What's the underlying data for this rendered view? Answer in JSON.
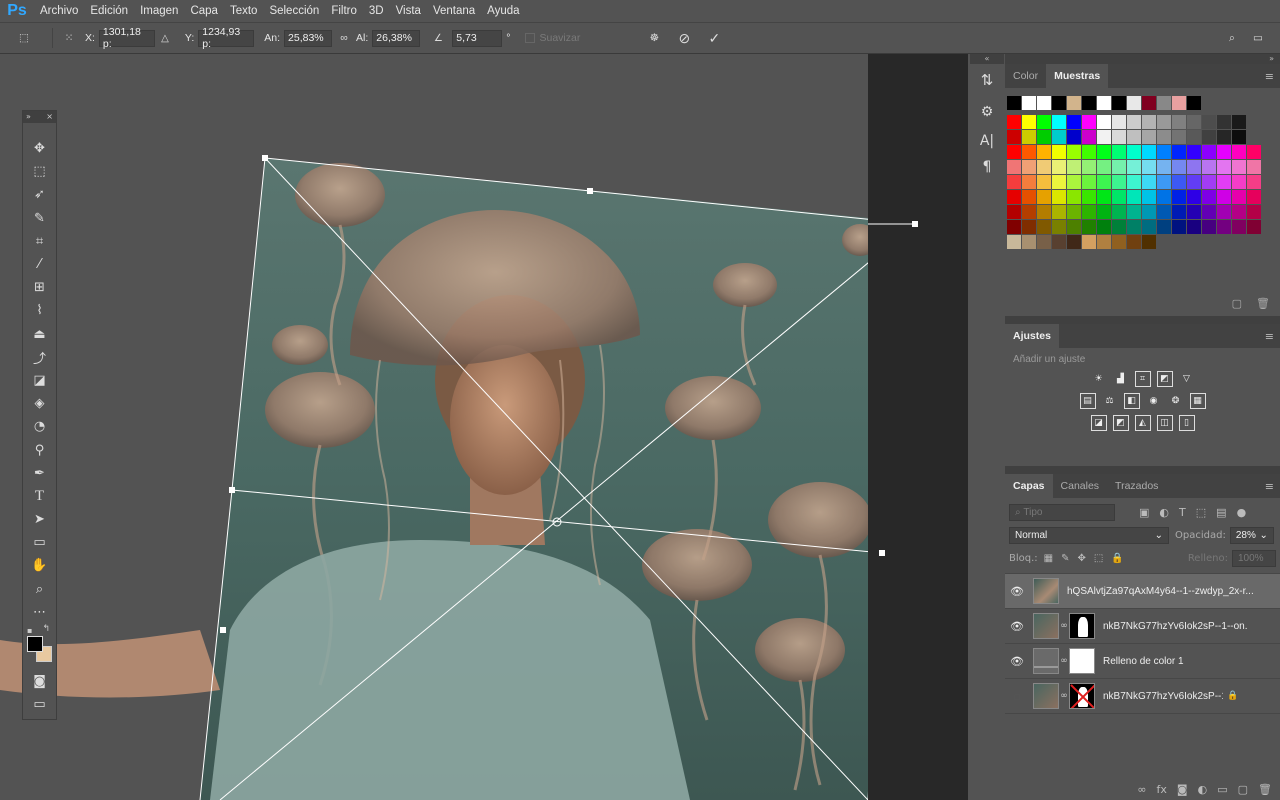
{
  "app": {
    "logo": "Ps"
  },
  "menu": [
    "Archivo",
    "Edición",
    "Imagen",
    "Capa",
    "Texto",
    "Selección",
    "Filtro",
    "3D",
    "Vista",
    "Ventana",
    "Ayuda"
  ],
  "options": {
    "x_label": "X:",
    "x_value": "1301,18 p:",
    "y_label": "Y:",
    "y_value": "1234,93 p:",
    "w_label": "An:",
    "w_value": "25,83%",
    "h_label": "Al:",
    "h_value": "26,38%",
    "angle_value": "5,73",
    "angle_unit": "°",
    "smooth_label": "Suavizar"
  },
  "color_panel": {
    "tabs": [
      "Color",
      "Muestras"
    ],
    "active_tab": "Muestras",
    "recent_swatches": [
      "#000000",
      "#ffffff",
      "#ffffff",
      "#000000",
      "#d2b48c",
      "#000000",
      "#ffffff",
      "#000000",
      "#e8e8e8",
      "#800020",
      "#888888",
      "#e8a0a0",
      "#000000"
    ]
  },
  "adjustments_panel": {
    "title": "Ajustes",
    "hint": "Añadir un ajuste"
  },
  "layers_panel": {
    "tabs": [
      "Capas",
      "Canales",
      "Trazados"
    ],
    "active_tab": "Capas",
    "filter_placeholder": "Tipo",
    "blend_mode": "Normal",
    "opacity_label": "Opacidad:",
    "opacity_value": "28%",
    "lock_label": "Bloq.:",
    "fill_label": "Relleno:",
    "fill_value": "100%",
    "layers": [
      {
        "name": "hQSAlvtjZa97qAxM4y64--1--zwdyp_2x-r...",
        "visible": true,
        "selected": true,
        "has_mask": false
      },
      {
        "name": "nkB7NkG77hzYv6Iok2sP--1--on...",
        "visible": true,
        "selected": false,
        "has_mask": true
      },
      {
        "name": "Relleno de color 1",
        "visible": true,
        "selected": false,
        "has_mask": true
      },
      {
        "name": "nkB7NkG77hzYv6Iok2sP--1-...",
        "visible": false,
        "selected": false,
        "has_mask": true,
        "locked": true
      }
    ]
  },
  "colors": {
    "foreground": "#000000",
    "background": "#e8c9a0",
    "accent": "#31a8ff"
  }
}
